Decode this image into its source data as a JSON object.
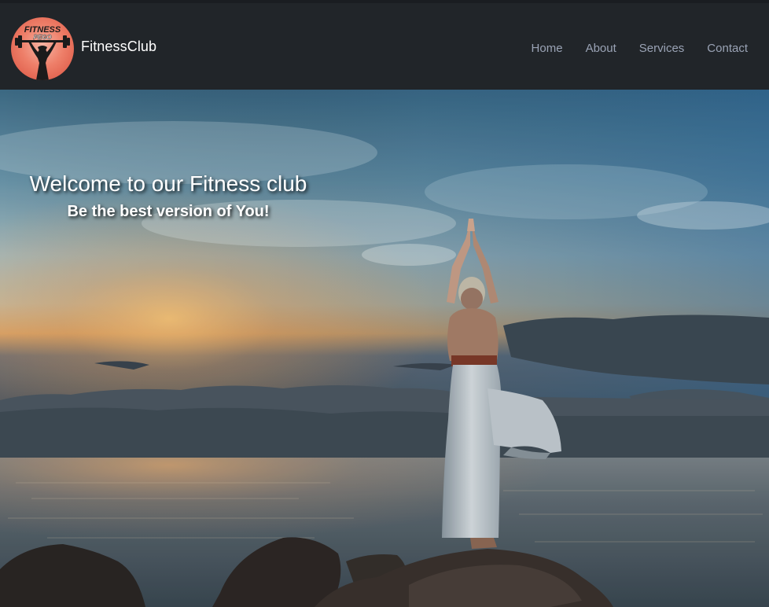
{
  "navbar": {
    "brand_name": "FitnessClub",
    "logo_text_top": "FITNESS",
    "logo_text_bottom": "PEGO",
    "links": [
      {
        "label": "Home"
      },
      {
        "label": "About"
      },
      {
        "label": "Services"
      },
      {
        "label": "Contact"
      }
    ]
  },
  "hero": {
    "title": "Welcome to our Fitness club",
    "subtitle": "Be the best version of You!",
    "image_subject": "woman-doing-yoga-tree-pose-at-sunset-sea"
  },
  "colors": {
    "navbar_bg": "#212529",
    "nav_link": "#9aa3b5",
    "logo_accent": "#ee7f69",
    "hero_text": "#ffffff"
  }
}
